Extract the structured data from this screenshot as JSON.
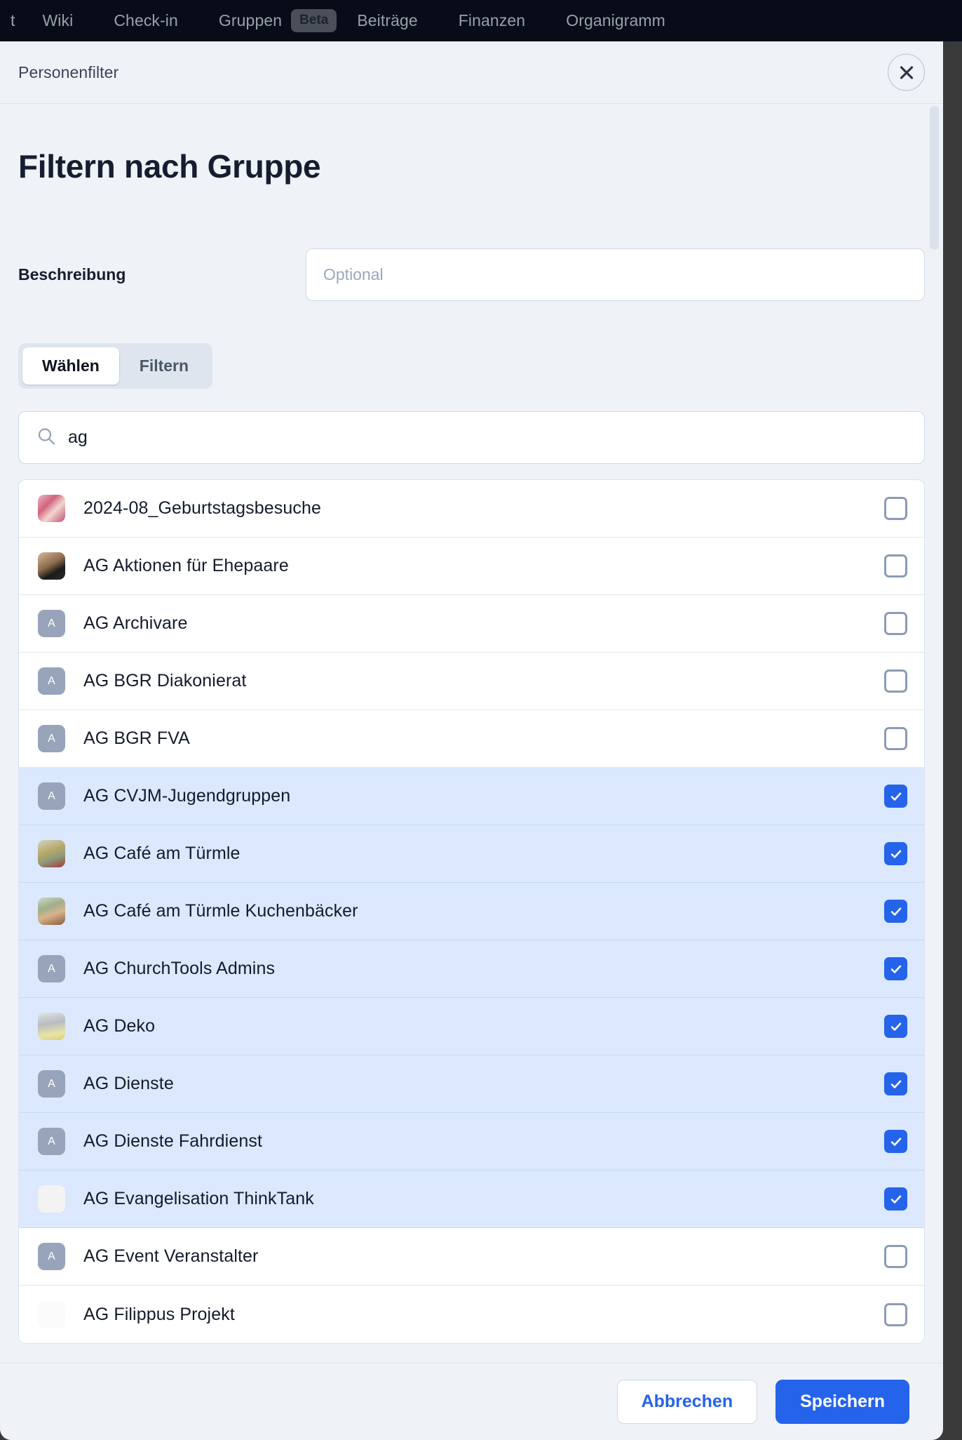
{
  "topnav": {
    "items": [
      {
        "label": "t",
        "truncated": true
      },
      {
        "label": "Wiki"
      },
      {
        "label": "Check-in"
      },
      {
        "label": "Gruppen",
        "badge": "Beta"
      },
      {
        "label": "Beiträge"
      },
      {
        "label": "Finanzen"
      },
      {
        "label": "Organigramm"
      }
    ]
  },
  "modal": {
    "header_title": "Personenfilter",
    "close_label": "×",
    "page_title": "Filtern nach Gruppe",
    "description": {
      "label": "Beschreibung",
      "value": "",
      "placeholder": "Optional"
    },
    "segmented": {
      "options": [
        "Wählen",
        "Filtern"
      ],
      "active": "Wählen"
    },
    "search": {
      "value": "ag",
      "placeholder": "",
      "icon": "search-icon"
    },
    "footer": {
      "cancel_label": "Abbrechen",
      "save_label": "Speichern"
    }
  },
  "groups": [
    {
      "label": "2024-08_Geburtstagsbesuche",
      "avatar_type": "photo",
      "avatar_class": "ph-gift",
      "avatar_text": "",
      "checked": false
    },
    {
      "label": "AG Aktionen für Ehepaare",
      "avatar_type": "photo",
      "avatar_class": "ph-hand",
      "avatar_text": "",
      "checked": false
    },
    {
      "label": "AG Archivare",
      "avatar_type": "initial",
      "avatar_class": "",
      "avatar_text": "A",
      "checked": false
    },
    {
      "label": "AG BGR Diakonierat",
      "avatar_type": "initial",
      "avatar_class": "",
      "avatar_text": "A",
      "checked": false
    },
    {
      "label": "AG BGR FVA",
      "avatar_type": "initial",
      "avatar_class": "",
      "avatar_text": "A",
      "checked": false
    },
    {
      "label": "AG CVJM-Jugendgruppen",
      "avatar_type": "initial",
      "avatar_class": "",
      "avatar_text": "A",
      "checked": true
    },
    {
      "label": "AG Café am Türmle",
      "avatar_type": "photo",
      "avatar_class": "ph-cafe1",
      "avatar_text": "",
      "checked": true
    },
    {
      "label": "AG Café am Türmle Kuchenbäcker",
      "avatar_type": "photo",
      "avatar_class": "ph-cafe2",
      "avatar_text": "",
      "checked": true
    },
    {
      "label": "AG ChurchTools Admins",
      "avatar_type": "initial",
      "avatar_class": "",
      "avatar_text": "A",
      "checked": true
    },
    {
      "label": "AG Deko",
      "avatar_type": "photo",
      "avatar_class": "ph-deko",
      "avatar_text": "",
      "checked": true
    },
    {
      "label": "AG Dienste",
      "avatar_type": "initial",
      "avatar_class": "",
      "avatar_text": "A",
      "checked": true
    },
    {
      "label": "AG Dienste Fahrdienst",
      "avatar_type": "initial",
      "avatar_class": "",
      "avatar_text": "A",
      "checked": true
    },
    {
      "label": "AG Evangelisation ThinkTank",
      "avatar_type": "photo",
      "avatar_class": "ph-think",
      "avatar_text": "",
      "checked": true
    },
    {
      "label": "AG Event Veranstalter",
      "avatar_type": "initial",
      "avatar_class": "",
      "avatar_text": "A",
      "checked": false
    },
    {
      "label": "AG Filippus Projekt",
      "avatar_type": "photo",
      "avatar_class": "ph-filip",
      "avatar_text": "",
      "checked": false
    }
  ],
  "colors": {
    "accent": "#2563eb",
    "selected_row": "#dbe8fd",
    "modal_bg": "#eff2f7",
    "nav_bg": "#080c18",
    "avatar_bg": "#97a4ba"
  }
}
